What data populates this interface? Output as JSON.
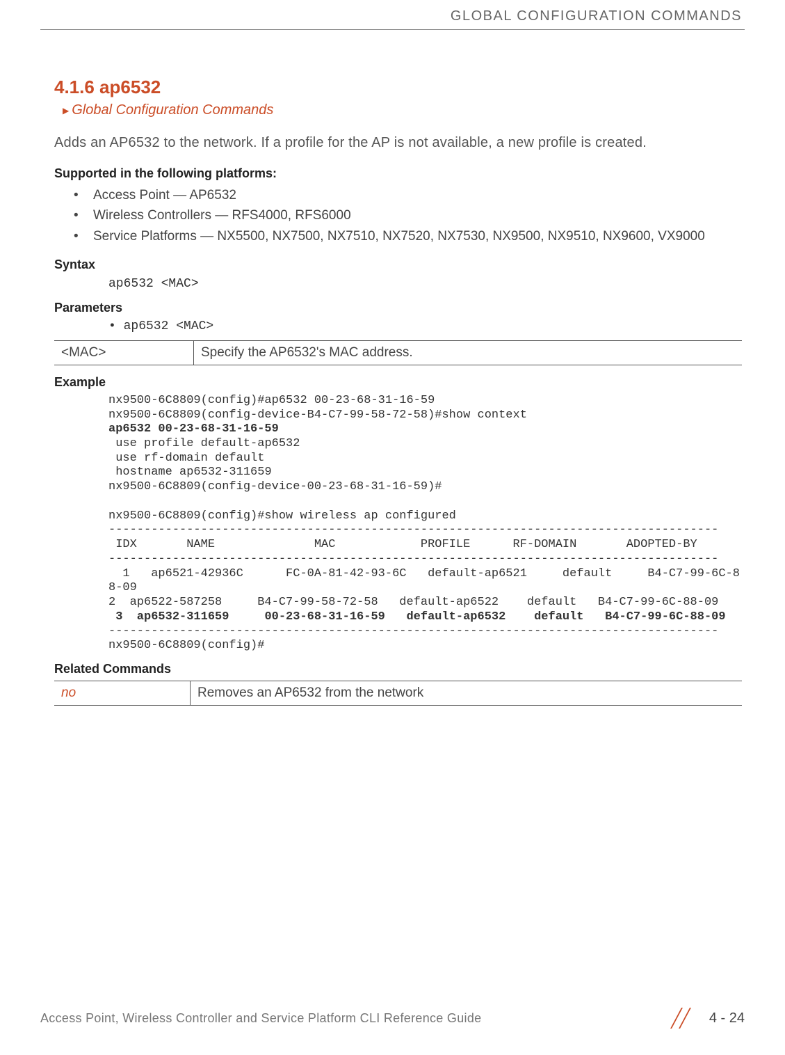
{
  "header": {
    "running_head": "GLOBAL CONFIGURATION COMMANDS"
  },
  "section": {
    "number_title": "4.1.6 ap6532",
    "breadcrumb": "Global Configuration Commands",
    "description": "Adds an AP6532 to the network. If a profile for the AP is not available, a new profile is created."
  },
  "supported": {
    "heading": "Supported in the following platforms:",
    "items": [
      "Access Point — AP6532",
      "Wireless Controllers — RFS4000, RFS6000",
      "Service Platforms — NX5500, NX7500, NX7510, NX7520, NX7530, NX9500, NX9510, NX9600, VX9000"
    ]
  },
  "syntax": {
    "heading": "Syntax",
    "code": "ap6532 <MAC>"
  },
  "parameters": {
    "heading": "Parameters",
    "bullet": "• ap6532 <MAC>",
    "table": {
      "key": "<MAC>",
      "desc": "Specify the AP6532's MAC address."
    }
  },
  "example": {
    "heading": "Example",
    "line1": "nx9500-6C8809(config)#ap6532 00-23-68-31-16-59",
    "line2": "nx9500-6C8809(config-device-B4-C7-99-58-72-58)#show context",
    "line3_bold": "ap6532 00-23-68-31-16-59",
    "line4": " use profile default-ap6532",
    "line5": " use rf-domain default",
    "line6": " hostname ap6532-311659",
    "line7": "nx9500-6C8809(config-device-00-23-68-31-16-59)#",
    "blank": "",
    "line8": "nx9500-6C8809(config)#show wireless ap configured",
    "sep": "--------------------------------------------------------------------------------------",
    "header_row": " IDX       NAME              MAC            PROFILE      RF-DOMAIN       ADOPTED-BY",
    "row1": "  1   ap6521-42936C      FC-0A-81-42-93-6C   default-ap6521     default     B4-C7-99-6C-88-09",
    "row2": "2  ap6522-587258     B4-C7-99-58-72-58   default-ap6522    default   B4-C7-99-6C-88-09",
    "row3_bold": " 3  ap6532-311659     00-23-68-31-16-59   default-ap6532    default   B4-C7-99-6C-88-09",
    "lineLast": "nx9500-6C8809(config)#"
  },
  "related": {
    "heading": "Related Commands",
    "key": "no",
    "desc": "Removes an AP6532 from the network"
  },
  "footer": {
    "guide_title": "Access Point, Wireless Controller and Service Platform CLI Reference Guide",
    "page_number": "4 - 24"
  }
}
